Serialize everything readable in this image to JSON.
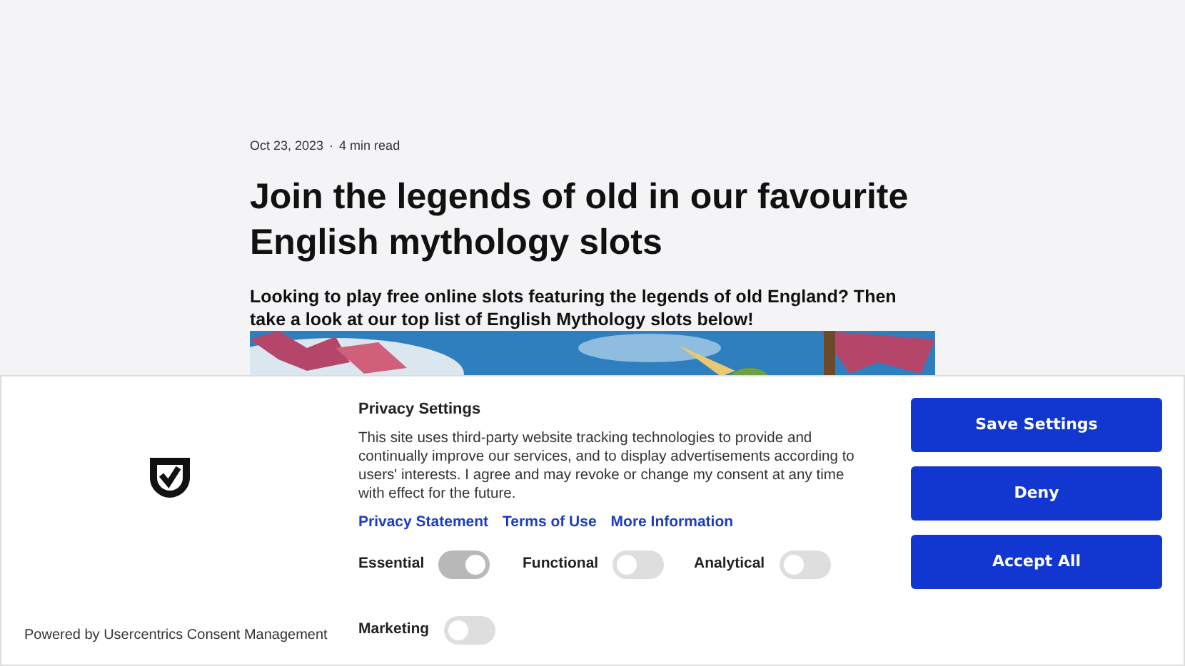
{
  "article": {
    "date": "Oct 23, 2023",
    "separator": "·",
    "read_time": "4 min read",
    "title": "Join the legends of old in our favourite English mythology slots",
    "subtitle": "Looking to play free online slots featuring the legends of old England? Then take a look at our top list of English Mythology slots below!"
  },
  "consent_banner": {
    "powered_by": "Powered by Usercentrics Consent Management",
    "title": "Privacy Settings",
    "text": "This site uses third-party website tracking technologies to provide and continually improve our services, and to display advertisements according to users' interests. I agree and may revoke or change my consent at any time with effect for the future.",
    "links": [
      "Privacy Statement",
      "Terms of Use",
      "More Information"
    ],
    "toggles": [
      {
        "label": "Essential",
        "on": true,
        "disabled": true
      },
      {
        "label": "Functional",
        "on": false,
        "disabled": false
      },
      {
        "label": "Analytical",
        "on": false,
        "disabled": false
      },
      {
        "label": "Marketing",
        "on": false,
        "disabled": false
      }
    ],
    "buttons": [
      "Save Settings",
      "Deny",
      "Accept All"
    ]
  }
}
